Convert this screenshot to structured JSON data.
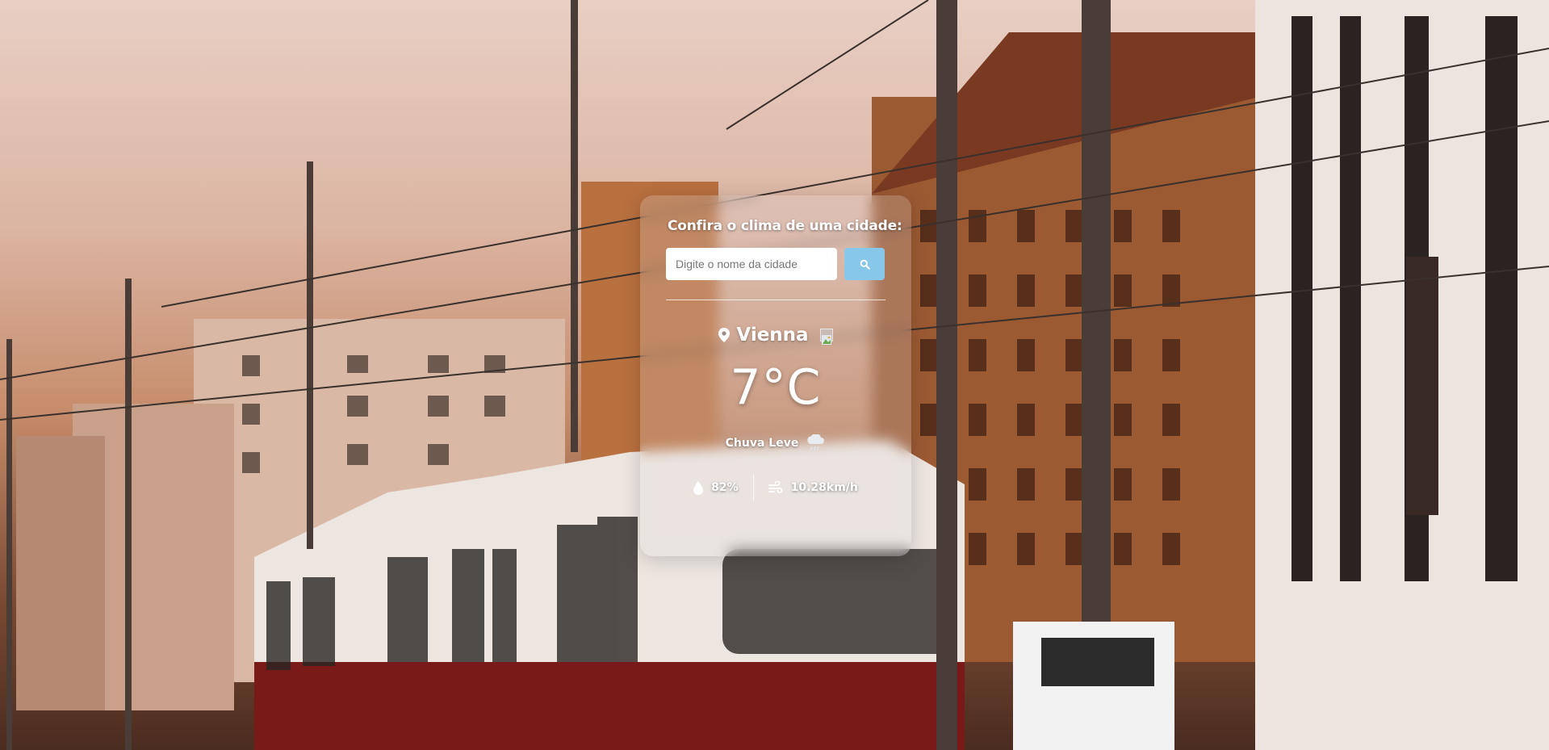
{
  "search": {
    "title": "Confira o clima de uma cidade:",
    "placeholder": "Digite o nome da cidade",
    "value": ""
  },
  "weather": {
    "city": "Vienna",
    "temperature": "7",
    "unit": "°C",
    "description": "Chuva Leve",
    "humidity": "82%",
    "wind": "10.28km/h"
  },
  "icons": {
    "location": "map-pin-icon",
    "search": "magnifier-icon",
    "flag": "broken-image-icon",
    "weather": "cloud-rain-icon",
    "humidity": "droplet-icon",
    "wind": "wind-icon"
  },
  "colors": {
    "search_button": "#87c8ea",
    "text": "#ffffff"
  }
}
